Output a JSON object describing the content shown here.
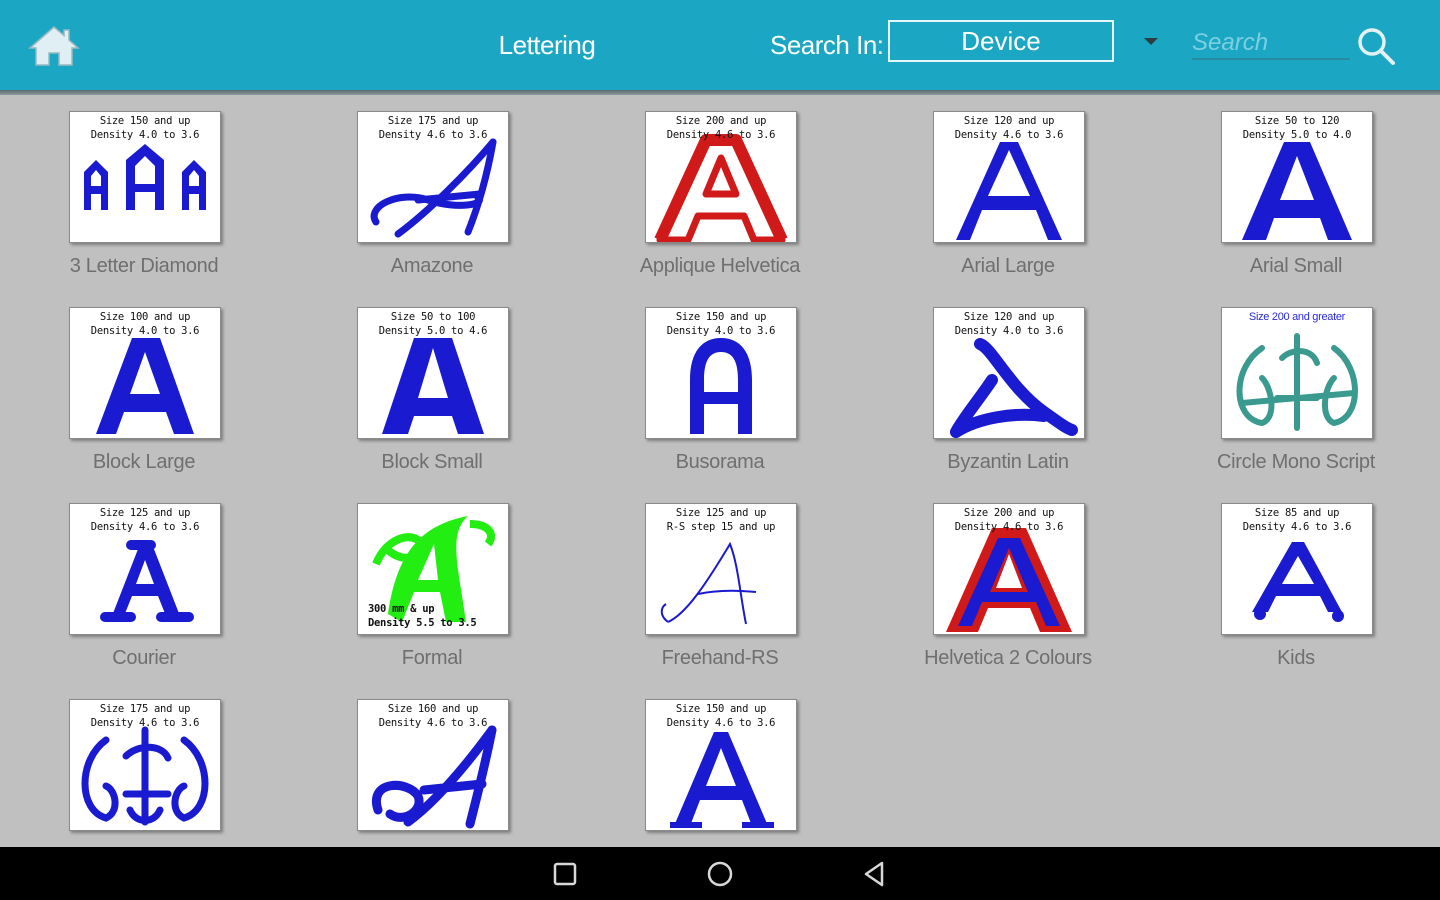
{
  "header": {
    "title": "Lettering",
    "search_in_label": "Search In:",
    "search_in_value": "Device",
    "search_placeholder": "Search"
  },
  "fonts": [
    {
      "name": "3 Letter Diamond",
      "info": "Size 150 and up\nDensity 4.0 to 3.6",
      "style": "diamond"
    },
    {
      "name": "Amazone",
      "info": "Size 175 and up\nDensity 4.6 to 3.6",
      "style": "script"
    },
    {
      "name": "Applique Helvetica",
      "info": "Size 200 and up\nDensity 4.6 to 3.6",
      "style": "applique"
    },
    {
      "name": "Arial Large",
      "info": "Size 120 and up\nDensity 4.6 to 3.6",
      "style": "thin"
    },
    {
      "name": "Arial Small",
      "info": "Size 50 to 120\nDensity 5.0 to 4.0",
      "style": "thick"
    },
    {
      "name": "Block Large",
      "info": "Size 100 and up\nDensity 4.0 to 3.6",
      "style": "block"
    },
    {
      "name": "Block Small",
      "info": "Size 50 to 100\nDensity 5.0 to 4.6",
      "style": "blocksmall"
    },
    {
      "name": "Busorama",
      "info": "Size 150 and up\nDensity 4.0 to 3.6",
      "style": "busorama"
    },
    {
      "name": "Byzantin Latin",
      "info": "Size 120 and up\nDensity 4.0 to 3.6",
      "style": "byzantin"
    },
    {
      "name": "Circle Mono Script",
      "info": "Size 200 and greater",
      "style": "circlemono"
    },
    {
      "name": "Courier",
      "info": "Size 125 and up\nDensity 4.6 to 3.6",
      "style": "courier"
    },
    {
      "name": "Formal",
      "info": "300 mm & up\nDensity 5.5 to 3.5",
      "style": "formal"
    },
    {
      "name": "Freehand-RS",
      "info": "Size 125 and up\nR-S step 15 and up",
      "style": "freehand"
    },
    {
      "name": "Helvetica 2 Colours",
      "info": "Size 200 and up\nDensity 4.6 to 3.6",
      "style": "twocolor"
    },
    {
      "name": "Kids",
      "info": "Size 85 and up\nDensity 4.6 to 3.6",
      "style": "kids"
    },
    {
      "name": "",
      "info": "Size 175 and up\nDensity 4.6 to 3.6",
      "style": "monogram"
    },
    {
      "name": "",
      "info": "Size 160 and up\nDensity 4.6 to 3.6",
      "style": "swirl"
    },
    {
      "name": "",
      "info": "Size 150 and up\nDensity 4.6 to 3.6",
      "style": "serif"
    }
  ],
  "icons": {
    "home": "home-icon",
    "search": "search-icon",
    "dropdown": "chevron-down-icon",
    "recents": "square-icon",
    "home_nav": "circle-icon",
    "back": "triangle-back-icon"
  },
  "colors": {
    "header": "#1ba7c3",
    "background": "#c0c0c0",
    "navbar": "#000000",
    "glyph_blue": "#1a1ad0",
    "glyph_red": "#d01a1a",
    "glyph_green": "#22ee11",
    "glyph_teal": "#3a9a90"
  }
}
